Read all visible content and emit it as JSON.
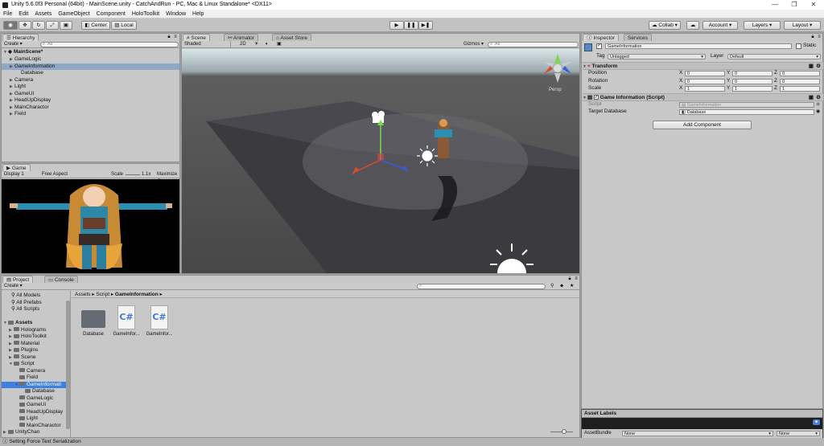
{
  "window": {
    "title": "Unity 5.6.0f3 Personal (64bit) - MainScene.unity - CatchAndRun - PC, Mac & Linux Standalone* <DX11>",
    "controls": [
      "—",
      "❐",
      "✕"
    ]
  },
  "menu": [
    "File",
    "Edit",
    "Assets",
    "GameObject",
    "Component",
    "HoloToolkit",
    "Window",
    "Help"
  ],
  "toolbar": {
    "center_label": "Center",
    "local_label": "Local",
    "collab_label": "Collab ▾",
    "account_label": "Account ▾",
    "layers_label": "Layers",
    "layout_label": "Layout"
  },
  "hierarchy": {
    "tab": "Hierarchy",
    "create_label": "Create ▾",
    "search_placeholder": "All",
    "scene_name": "MainScene*",
    "items": [
      {
        "label": "GameLogic",
        "depth": 1,
        "expandable": true,
        "selected": false
      },
      {
        "label": "GameInformation",
        "depth": 1,
        "expandable": true,
        "selected": true
      },
      {
        "label": "Database",
        "depth": 2,
        "expandable": false,
        "selected": false
      },
      {
        "label": "Camera",
        "depth": 1,
        "expandable": true,
        "selected": false
      },
      {
        "label": "Light",
        "depth": 1,
        "expandable": true,
        "selected": false
      },
      {
        "label": "GameUI",
        "depth": 1,
        "expandable": true,
        "selected": false
      },
      {
        "label": "HeadUpDisplay",
        "depth": 1,
        "expandable": true,
        "selected": false
      },
      {
        "label": "MainCharactor",
        "depth": 1,
        "expandable": true,
        "selected": false
      },
      {
        "label": "Field",
        "depth": 1,
        "expandable": true,
        "selected": false
      }
    ]
  },
  "scene": {
    "tabs": [
      "Scene",
      "Animator",
      "Asset Store"
    ],
    "shaded_label": "Shaded",
    "mode_2d": "2D",
    "gizmos_label": "Gizmos ▾",
    "search_placeholder": "All",
    "persp_label": "Persp"
  },
  "game": {
    "tab": "Game",
    "display_label": "Display 1",
    "aspect_label": "Free Aspect",
    "scale_label": "Scale",
    "scale_value": "1.1x",
    "maximize_label": "Maximize O"
  },
  "inspector": {
    "tabs": [
      "Inspector",
      "Services"
    ],
    "object_name": "GameInformation",
    "static_label": "Static",
    "tag_label": "Tag",
    "tag_value": "Untagged",
    "layer_label": "Layer",
    "layer_value": "Default",
    "transform": {
      "title": "Transform",
      "rows": [
        {
          "label": "Position",
          "x": "0",
          "y": "0",
          "z": "0"
        },
        {
          "label": "Rotation",
          "x": "0",
          "y": "0",
          "z": "0"
        },
        {
          "label": "Scale",
          "x": "1",
          "y": "1",
          "z": "1"
        }
      ]
    },
    "script_component": {
      "title": "Game Information (Script)",
      "script_label": "Script",
      "script_value": "GameInformation",
      "target_label": "Target Database",
      "target_value": "Database"
    },
    "add_component_label": "Add Component"
  },
  "project": {
    "tabs": [
      "Project",
      "Console"
    ],
    "create_label": "Create ▾",
    "favorites": [
      "All Models",
      "All Prefabs",
      "All Scripts"
    ],
    "tree": [
      {
        "label": "Assets",
        "depth": 0,
        "bold": true
      },
      {
        "label": "Holograms",
        "depth": 1
      },
      {
        "label": "HoloToolkit",
        "depth": 1
      },
      {
        "label": "Material",
        "depth": 1
      },
      {
        "label": "Plugins",
        "depth": 1
      },
      {
        "label": "Scene",
        "depth": 1
      },
      {
        "label": "Script",
        "depth": 1
      },
      {
        "label": "Camera",
        "depth": 2
      },
      {
        "label": "Field",
        "depth": 2
      },
      {
        "label": "GameInformati",
        "depth": 2,
        "selected": true
      },
      {
        "label": "Database",
        "depth": 3
      },
      {
        "label": "GameLogic",
        "depth": 2
      },
      {
        "label": "GameUI",
        "depth": 2
      },
      {
        "label": "HeadUpDisplay",
        "depth": 2
      },
      {
        "label": "Light",
        "depth": 2
      },
      {
        "label": "MainCharactor",
        "depth": 2
      },
      {
        "label": "UnityChan",
        "depth": 0
      }
    ],
    "breadcrumb": [
      "Assets",
      "Script",
      "GameInformation"
    ],
    "assets": [
      {
        "label": "Database",
        "type": "folder"
      },
      {
        "label": "GameInfor...",
        "type": "csharp"
      },
      {
        "label": "GameInfor...",
        "type": "csharp"
      }
    ]
  },
  "asset_labels": {
    "title": "Asset Labels",
    "bundle_label": "AssetBundle",
    "bundle_value": "None",
    "variant_value": "None"
  },
  "status": {
    "message": "Setting Force Text Serialization"
  }
}
